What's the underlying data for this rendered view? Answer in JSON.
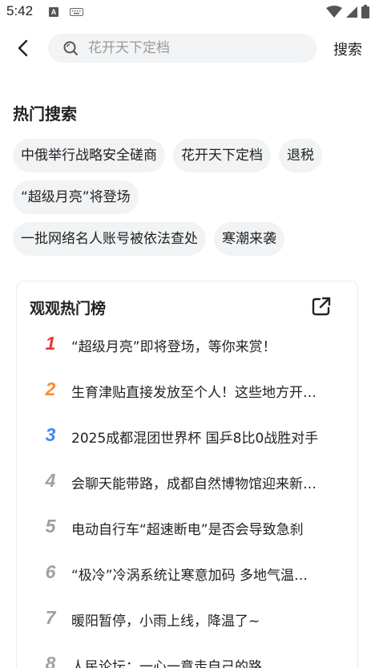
{
  "status_bar": {
    "time": "5:42",
    "a_badge": "A"
  },
  "search": {
    "placeholder": "花开天下定档",
    "submit_label": "搜索"
  },
  "hot_search": {
    "title": "热门搜索",
    "rows": [
      [
        "中俄举行战略安全磋商",
        "花开天下定档",
        "退税"
      ],
      [
        "“超级月亮”将登场"
      ],
      [
        "一批网络名人账号被依法查处",
        "寒潮来袭"
      ]
    ]
  },
  "ranking": {
    "title": "观观热门榜",
    "items": [
      {
        "rank": "1",
        "text": "“超级月亮”即将登场，等你来赏！"
      },
      {
        "rank": "2",
        "text": "生育津贴直接发放至个人！这些地方开始实施了"
      },
      {
        "rank": "3",
        "text": "2025成都混团世界杯  国乒8比0战胜对手"
      },
      {
        "rank": "4",
        "text": "会聊天能带路，成都自然博物馆迎来新成员"
      },
      {
        "rank": "5",
        "text": "电动自行车“超速断电”是否会导致急刹"
      },
      {
        "rank": "6",
        "text": "“极冷”冷涡系统让寒意加码  多地气温创新低"
      },
      {
        "rank": "7",
        "text": "暖阳暂停，小雨上线，降温了~"
      },
      {
        "rank": "8",
        "text": "人民论坛：一心一意走自己的路"
      }
    ]
  },
  "colors": {
    "rank1": "#e53935",
    "rank2": "#fb8c2a",
    "rank3": "#3f86f5",
    "rank_other": "#a0a0a0",
    "chip_bg": "#f1f3f5"
  },
  "icons": {
    "back": "chevron-left-icon",
    "search": "search-icon",
    "share": "share-icon",
    "wifi": "wifi-icon",
    "signal": "signal-icon",
    "battery": "battery-icon",
    "keyboard": "keyboard-icon"
  }
}
